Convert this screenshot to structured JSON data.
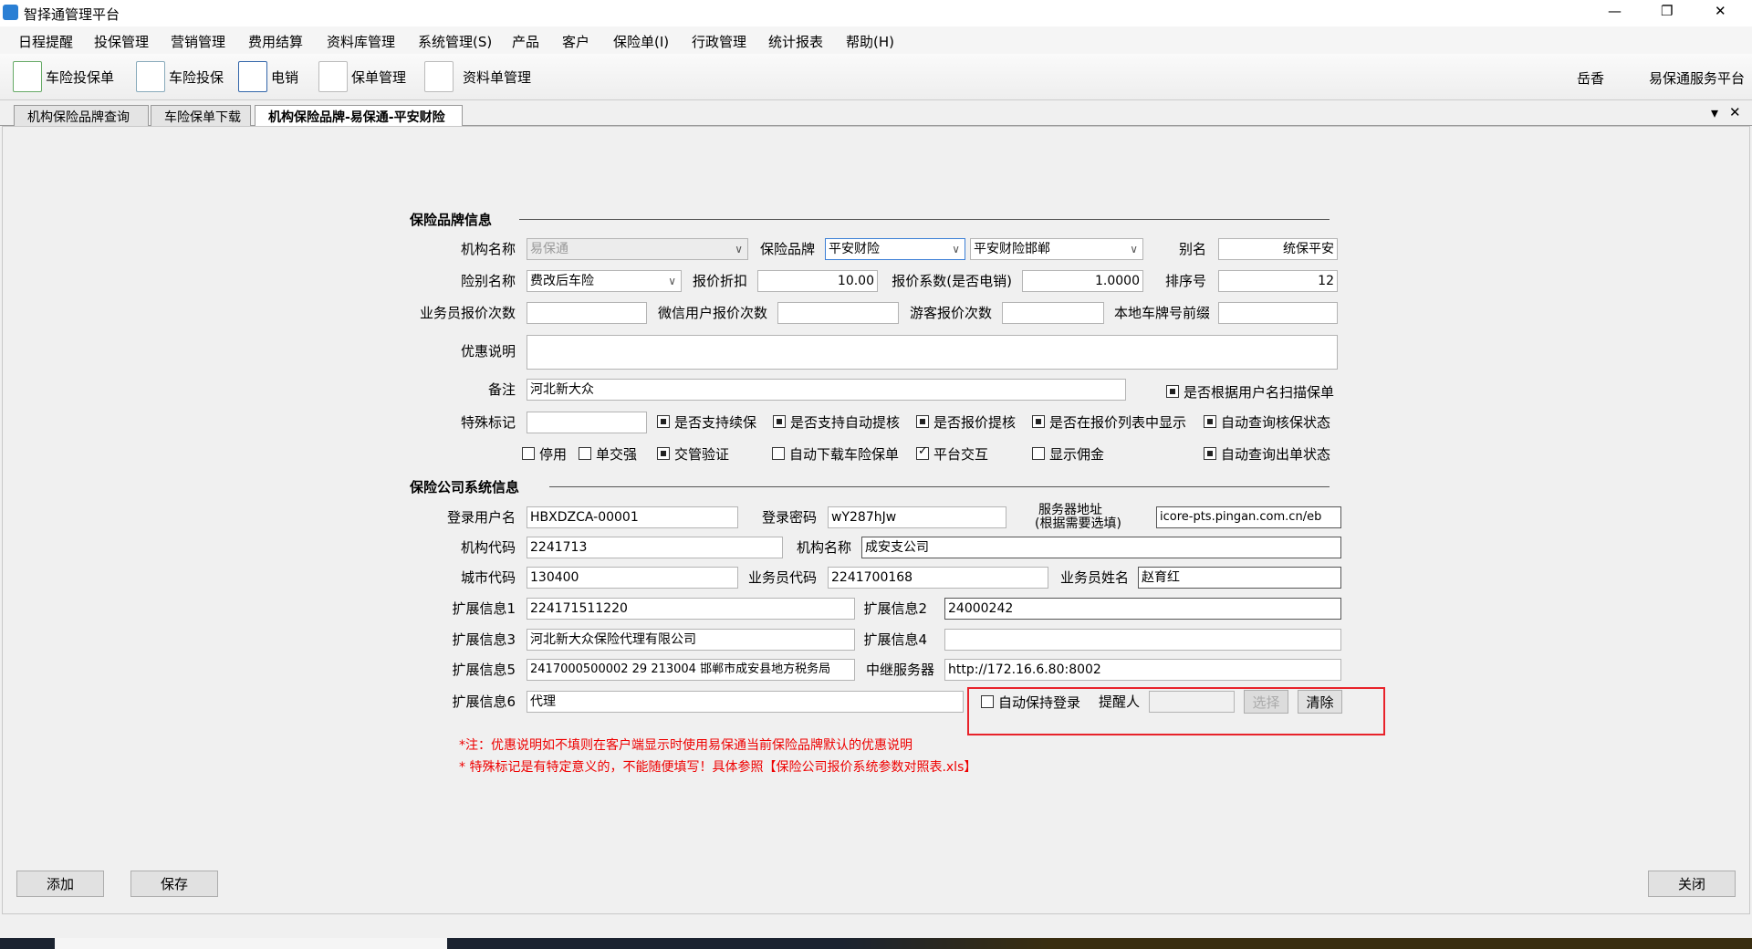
{
  "window": {
    "title": "智择通管理平台",
    "minimize": "—",
    "restore": "❐",
    "close": "✕"
  },
  "menu": [
    "日程提醒",
    "投保管理",
    "营销管理",
    "费用结算",
    "资料库管理",
    "系统管理(S)",
    "产品",
    "客户",
    "保险单(I)",
    "行政管理",
    "统计报表",
    "帮助(H)"
  ],
  "toolbar": {
    "items": [
      "车险投保单",
      "车险投保",
      "电销",
      "保单管理",
      "资料单管理"
    ],
    "user": "岳香",
    "platform": "易保通服务平台"
  },
  "tabs": {
    "items": [
      "机构保险品牌查询",
      "车险保单下载",
      "机构保险品牌-易保通-平安财险"
    ],
    "active": 2,
    "dropdown": "▾",
    "close": "✕"
  },
  "brand": {
    "title": "保险品牌信息",
    "org_name_label": "机构名称",
    "org_name": "易保通",
    "brand_label": "保险品牌",
    "brand": "平安财险",
    "brand_branch": "平安财险邯郸",
    "alias_label": "别名",
    "alias": "统保平安",
    "type_label": "险别名称",
    "type": "费改后车险",
    "discount_label": "报价折扣",
    "discount": "10.00",
    "coef_label": "报价系数(是否电销)",
    "coef": "1.0000",
    "sort_label": "排序号",
    "sort": "12",
    "agent_count_label": "业务员报价次数",
    "agent_count": "",
    "wechat_count_label": "微信用户报价次数",
    "wechat_count": "",
    "guest_count_label": "游客报价次数",
    "guest_count": "",
    "plate_prefix_label": "本地车牌号前缀",
    "plate_prefix": "",
    "promo_label": "优惠说明",
    "promo": "",
    "remark_label": "备注",
    "remark": "河北新大众",
    "special_label": "特殊标记",
    "special": "",
    "checkboxes": [
      {
        "label": "是否根据用户名扫描保单",
        "state": "filled"
      },
      {
        "label": "是否支持续保",
        "state": "filled"
      },
      {
        "label": "是否支持自动提核",
        "state": "filled"
      },
      {
        "label": "是否报价提核",
        "state": "filled"
      },
      {
        "label": "是否在报价列表中显示",
        "state": "filled"
      },
      {
        "label": "自动查询核保状态",
        "state": "filled"
      },
      {
        "label": "停用",
        "state": "none"
      },
      {
        "label": "单交强",
        "state": "none"
      },
      {
        "label": "交管验证",
        "state": "filled"
      },
      {
        "label": "自动下载车险保单",
        "state": "none"
      },
      {
        "label": "平台交互",
        "state": "tick"
      },
      {
        "label": "显示佣金",
        "state": "none"
      },
      {
        "label": "自动查询出单状态",
        "state": "filled"
      }
    ]
  },
  "system": {
    "title": "保险公司系统信息",
    "login_user_label": "登录用户名",
    "login_user": "HBXDZCA-00001",
    "login_pwd_label": "登录密码",
    "login_pwd": "wY287hJw",
    "server_label": "服务器地址",
    "server_hint": "(根据需要选填)",
    "server": "icore-pts.pingan.com.cn/eb",
    "org_code_label": "机构代码",
    "org_code": "2241713",
    "org_name_label": "机构名称",
    "org_name": "成安支公司",
    "city_code_label": "城市代码",
    "city_code": "130400",
    "agent_code_label": "业务员代码",
    "agent_code": "2241700168",
    "agent_name_label": "业务员姓名",
    "agent_name": "赵育红",
    "ext1_label": "扩展信息1",
    "ext1": "224171511220",
    "ext2_label": "扩展信息2",
    "ext2": "24000242",
    "ext3_label": "扩展信息3",
    "ext3": "河北新大众保险代理有限公司",
    "ext4_label": "扩展信息4",
    "ext4": "",
    "ext5_label": "扩展信息5",
    "ext5": "2417000500002 29 213004 邯郸市成安县地方税务局",
    "relay_label": "中继服务器",
    "relay": "http://172.16.6.80:8002",
    "ext6_label": "扩展信息6",
    "ext6": "代理",
    "keep_login": {
      "label": "自动保持登录",
      "state": "none"
    },
    "reminder_label": "提醒人",
    "reminder": "",
    "select_btn": "选择",
    "clear_btn": "清除"
  },
  "notes": [
    "*注：优惠说明如不填则在客户端显示时使用易保通当前保险品牌默认的优惠说明",
    "* 特殊标记是有特定意义的，不能随便填写！具体参照【保险公司报价系统参数对照表.xls】"
  ],
  "buttons": {
    "add": "添加",
    "save": "保存",
    "close": "关闭"
  },
  "colors": {
    "highlight_box": "#e8222a",
    "note": "#ee0000",
    "focus": "#3c7fd6"
  }
}
